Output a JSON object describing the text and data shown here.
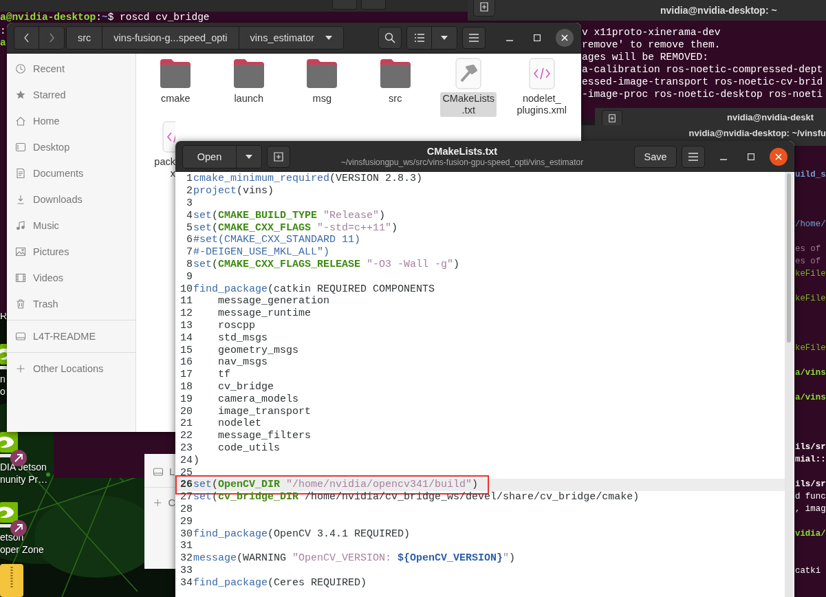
{
  "desktop": {
    "icons": [
      {
        "kind": "label",
        "lines": [
          "R"
        ]
      },
      {
        "kind": "app",
        "lines": [
          "n",
          "o"
        ]
      },
      {
        "kind": "app_link",
        "lines": [
          "DIA Jetson",
          "nunity Pr…"
        ]
      },
      {
        "kind": "app_link",
        "lines": [
          "etson",
          "oper Zone"
        ]
      },
      {
        "kind": "archive"
      }
    ]
  },
  "terminal_back": {
    "prompt": [
      {
        "text": "a@nvidia-desktop",
        "kind": "user"
      },
      {
        "text": ":",
        "kind": "plain"
      },
      {
        "text": "~",
        "kind": "path"
      },
      {
        "text": "$ roscd cv_bridge",
        "kind": "plain"
      }
    ],
    "edge_lines": [
      {
        "text": ":",
        "kind": "plain"
      },
      {
        "text": "a",
        "kind": "user"
      }
    ]
  },
  "terminal_upper": {
    "title": "nvidia@nvidia-desktop: ~",
    "lines": [
      "v x11proto-xinerama-dev",
      "remove' to remove them.",
      "ages will be REMOVED:",
      "a-calibration ros-noetic-compressed-dept",
      "essed-image-transport ros-noetic-cv-brid",
      "-image-proc ros-noetic-desktop ros-noeti"
    ]
  },
  "terminal_middle": {
    "title": "nvidia@nvidia-deskt"
  },
  "terminal_front": {
    "title": "nvidia@nvidia-desktop: ~/vinsfu",
    "lines": [
      {
        "text": "uild_s",
        "kind": "path"
      },
      {
        "text": "/home/",
        "kind": "path_light"
      },
      {
        "text": "es of",
        "kind": "dim"
      },
      {
        "text": "es of",
        "kind": "dim"
      },
      {
        "text": "keFile",
        "kind": "green"
      },
      {
        "text": "keFile",
        "kind": "green"
      },
      {
        "text": "keFile",
        "kind": "green"
      },
      {
        "text": "a/vins",
        "kind": "green_bold"
      },
      {
        "text": "a/vins",
        "kind": "green_bold"
      },
      {
        "text": "ils/sr",
        "kind": "bold"
      },
      {
        "text": "mial::",
        "kind": "bold"
      },
      {
        "text": "ils/sr",
        "kind": "bold"
      },
      {
        "text": "d func",
        "kind": "plain"
      },
      {
        "text": ", imag",
        "kind": "plain"
      },
      {
        "text": "vidia/",
        "kind": "green_bold"
      },
      {
        "text": "catki",
        "kind": "plain"
      }
    ]
  },
  "file_manager": {
    "path": [
      "src",
      "vins-fusion-g...speed_opti",
      "vins_estimator"
    ],
    "sidebar": [
      [
        {
          "label": "Recent",
          "kind": "recent"
        },
        {
          "label": "Starred",
          "kind": "starred"
        },
        {
          "label": "Home",
          "kind": "home"
        },
        {
          "label": "Desktop",
          "kind": "desktop"
        },
        {
          "label": "Documents",
          "kind": "documents"
        },
        {
          "label": "Downloads",
          "kind": "downloads"
        },
        {
          "label": "Music",
          "kind": "music"
        },
        {
          "label": "Pictures",
          "kind": "pictures"
        },
        {
          "label": "Videos",
          "kind": "videos"
        },
        {
          "label": "Trash",
          "kind": "trash"
        }
      ],
      [
        {
          "label": "L4T-README",
          "kind": "drive"
        }
      ],
      [
        {
          "label": "Other Locations",
          "kind": "add"
        }
      ]
    ],
    "files": [
      {
        "kind": "folder",
        "lines": [
          "cmake"
        ],
        "selected": false
      },
      {
        "kind": "folder",
        "lines": [
          "launch"
        ],
        "selected": false
      },
      {
        "kind": "folder",
        "lines": [
          "msg"
        ],
        "selected": false
      },
      {
        "kind": "folder",
        "lines": [
          "src"
        ],
        "selected": false
      },
      {
        "kind": "build",
        "lines": [
          "CMakeLists",
          ".txt"
        ],
        "selected": true
      },
      {
        "kind": "code",
        "lines": [
          "nodelet_",
          "plugins.xml"
        ],
        "selected": false
      },
      {
        "kind": "code",
        "lines": [
          "pack",
          "x"
        ],
        "selected": false
      }
    ]
  },
  "file_manager_back": {
    "sidebar": [
      {
        "label": "L",
        "kind": "drive"
      },
      {
        "label": "C",
        "kind": "add"
      }
    ]
  },
  "editor": {
    "open_label": "Open",
    "title": "CMakeLists.txt",
    "subtitle": "~/vinsfusiongpu_ws/src/vins-fusion-gpu-speed_opti/vins_estimator",
    "save_label": "Save",
    "lines": [
      {
        "n": "1",
        "current": false,
        "boxed": false,
        "segs": [
          {
            "text": "cmake_minimum_required",
            "kind": "cmd"
          },
          {
            "text": "(VERSION 2.8.3)",
            "kind": "plain"
          }
        ]
      },
      {
        "n": "2",
        "current": false,
        "boxed": false,
        "segs": [
          {
            "text": "project",
            "kind": "cmd"
          },
          {
            "text": "(vins)",
            "kind": "plain"
          }
        ]
      },
      {
        "n": "3",
        "current": false,
        "boxed": false
      },
      {
        "n": "4",
        "current": false,
        "boxed": false,
        "segs": [
          {
            "text": "set",
            "kind": "cmd"
          },
          {
            "text": "(",
            "kind": "plain"
          },
          {
            "text": "CMAKE_BUILD_TYPE",
            "kind": "var"
          },
          {
            "text": " \"Release\"",
            "kind": "str"
          },
          {
            "text": ")",
            "kind": "plain"
          }
        ]
      },
      {
        "n": "5",
        "current": false,
        "boxed": false,
        "segs": [
          {
            "text": "set",
            "kind": "cmd"
          },
          {
            "text": "(",
            "kind": "plain"
          },
          {
            "text": "CMAKE_CXX_FLAGS",
            "kind": "var"
          },
          {
            "text": " \"-std=c++11\"",
            "kind": "str"
          },
          {
            "text": ")",
            "kind": "plain"
          }
        ]
      },
      {
        "n": "6",
        "current": false,
        "boxed": false,
        "segs": [
          {
            "text": "#set(CMAKE_CXX_STANDARD 11)",
            "kind": "comment"
          }
        ]
      },
      {
        "n": "7",
        "current": false,
        "boxed": false,
        "segs": [
          {
            "text": "#-DEIGEN_USE_MKL_ALL\")",
            "kind": "comment"
          }
        ]
      },
      {
        "n": "8",
        "current": false,
        "boxed": false,
        "segs": [
          {
            "text": "set",
            "kind": "cmd"
          },
          {
            "text": "(",
            "kind": "plain"
          },
          {
            "text": "CMAKE_CXX_FLAGS_RELEASE",
            "kind": "var"
          },
          {
            "text": " \"-O3 -Wall -g\"",
            "kind": "str"
          },
          {
            "text": ")",
            "kind": "plain"
          }
        ]
      },
      {
        "n": "9",
        "current": false,
        "boxed": false
      },
      {
        "n": "10",
        "current": false,
        "boxed": false,
        "segs": [
          {
            "text": "find_package",
            "kind": "cmd"
          },
          {
            "text": "(catkin REQUIRED COMPONENTS",
            "kind": "plain"
          }
        ]
      },
      {
        "n": "11",
        "current": false,
        "boxed": false,
        "segs": [
          {
            "text": "    message_generation",
            "kind": "plain"
          }
        ]
      },
      {
        "n": "12",
        "current": false,
        "boxed": false,
        "segs": [
          {
            "text": "    message_runtime",
            "kind": "plain"
          }
        ]
      },
      {
        "n": "13",
        "current": false,
        "boxed": false,
        "segs": [
          {
            "text": "    roscpp",
            "kind": "plain"
          }
        ]
      },
      {
        "n": "14",
        "current": false,
        "boxed": false,
        "segs": [
          {
            "text": "    std_msgs",
            "kind": "plain"
          }
        ]
      },
      {
        "n": "15",
        "current": false,
        "boxed": false,
        "segs": [
          {
            "text": "    geometry_msgs",
            "kind": "plain"
          }
        ]
      },
      {
        "n": "16",
        "current": false,
        "boxed": false,
        "segs": [
          {
            "text": "    nav_msgs",
            "kind": "plain"
          }
        ]
      },
      {
        "n": "17",
        "current": false,
        "boxed": false,
        "segs": [
          {
            "text": "    tf",
            "kind": "plain"
          }
        ]
      },
      {
        "n": "18",
        "current": false,
        "boxed": false,
        "segs": [
          {
            "text": "    cv_bridge",
            "kind": "plain"
          }
        ]
      },
      {
        "n": "19",
        "current": false,
        "boxed": false,
        "segs": [
          {
            "text": "    camera_models",
            "kind": "plain"
          }
        ]
      },
      {
        "n": "20",
        "current": false,
        "boxed": false,
        "segs": [
          {
            "text": "    image_transport",
            "kind": "plain"
          }
        ]
      },
      {
        "n": "21",
        "current": false,
        "boxed": false,
        "segs": [
          {
            "text": "    nodelet",
            "kind": "plain"
          }
        ]
      },
      {
        "n": "22",
        "current": false,
        "boxed": false,
        "segs": [
          {
            "text": "    message_filters",
            "kind": "plain"
          }
        ]
      },
      {
        "n": "23",
        "current": false,
        "boxed": false,
        "segs": [
          {
            "text": "    code_utils",
            "kind": "plain"
          }
        ]
      },
      {
        "n": "24",
        "current": false,
        "boxed": false,
        "segs": [
          {
            "text": ")",
            "kind": "plain"
          }
        ]
      },
      {
        "n": "25",
        "current": false,
        "boxed": false
      },
      {
        "n": "26",
        "current": true,
        "boxed": true,
        "segs": [
          {
            "text": "set",
            "kind": "cmd"
          },
          {
            "text": "(",
            "kind": "plain"
          },
          {
            "text": "OpenCV_DIR",
            "kind": "var"
          },
          {
            "text": " \"/home/nvidia/opencv341/build\"",
            "kind": "str"
          },
          {
            "text": ")",
            "kind": "plain"
          }
        ]
      },
      {
        "n": "27",
        "current": false,
        "boxed": false,
        "segs": [
          {
            "text": "set",
            "kind": "cmd"
          },
          {
            "text": "(",
            "kind": "plain"
          },
          {
            "text": "cv_bridge_DIR",
            "kind": "var"
          },
          {
            "text": " /home/nvidia/cv_bridge_ws/devel/share/cv_bridge/cmake)",
            "kind": "plain"
          }
        ]
      },
      {
        "n": "28",
        "current": false,
        "boxed": false
      },
      {
        "n": "29",
        "current": false,
        "boxed": false
      },
      {
        "n": "30",
        "current": false,
        "boxed": false,
        "segs": [
          {
            "text": "find_package",
            "kind": "cmd"
          },
          {
            "text": "(OpenCV 3.4.1 REQUIRED)",
            "kind": "plain"
          }
        ]
      },
      {
        "n": "31",
        "current": false,
        "boxed": false
      },
      {
        "n": "32",
        "current": false,
        "boxed": false,
        "segs": [
          {
            "text": "message",
            "kind": "cmd"
          },
          {
            "text": "(WARNING ",
            "kind": "plain"
          },
          {
            "text": "\"OpenCV_VERSION: ",
            "kind": "str"
          },
          {
            "text": "${OpenCV_VERSION}",
            "kind": "ref"
          },
          {
            "text": "\"",
            "kind": "str"
          },
          {
            "text": ")",
            "kind": "plain"
          }
        ]
      },
      {
        "n": "33",
        "current": false,
        "boxed": false
      },
      {
        "n": "34",
        "current": false,
        "boxed": false,
        "segs": [
          {
            "text": "find_package",
            "kind": "cmd"
          },
          {
            "text": "(Ceres REQUIRED)",
            "kind": "plain"
          }
        ]
      }
    ]
  }
}
